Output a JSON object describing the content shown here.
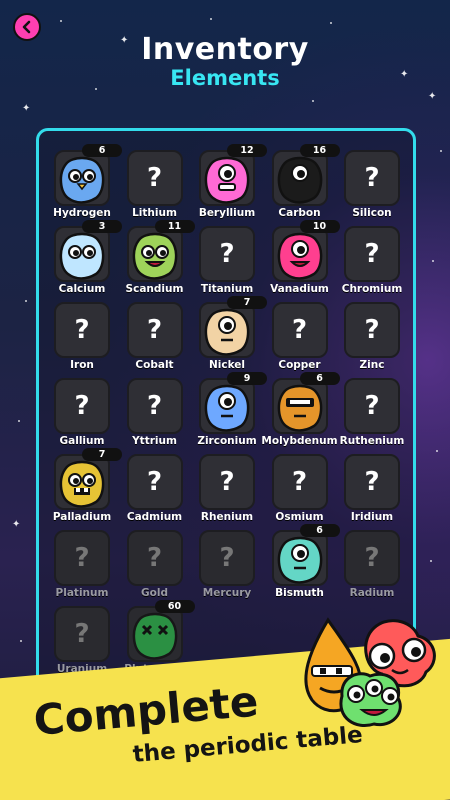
{
  "header": {
    "title": "Inventory",
    "subtitle": "Elements"
  },
  "colors": {
    "accent_cyan": "#33dceb",
    "back_button": "#ff3fb1",
    "banner": "#f6e24e"
  },
  "elements": [
    {
      "name": "Hydrogen",
      "count": "6",
      "discovered": true
    },
    {
      "name": "Lithium",
      "discovered": false
    },
    {
      "name": "Beryllium",
      "count": "12",
      "discovered": true
    },
    {
      "name": "Carbon",
      "count": "16",
      "discovered": true
    },
    {
      "name": "Silicon",
      "discovered": false
    },
    {
      "name": "Calcium",
      "count": "3",
      "discovered": true
    },
    {
      "name": "Scandium",
      "count": "11",
      "discovered": true
    },
    {
      "name": "Titanium",
      "discovered": false
    },
    {
      "name": "Vanadium",
      "count": "10",
      "discovered": true
    },
    {
      "name": "Chromium",
      "discovered": false
    },
    {
      "name": "Iron",
      "discovered": false
    },
    {
      "name": "Cobalt",
      "discovered": false
    },
    {
      "name": "Nickel",
      "count": "7",
      "discovered": true
    },
    {
      "name": "Copper",
      "discovered": false
    },
    {
      "name": "Zinc",
      "discovered": false
    },
    {
      "name": "Gallium",
      "discovered": false
    },
    {
      "name": "Yttrium",
      "discovered": false
    },
    {
      "name": "Zirconium",
      "count": "9",
      "discovered": true
    },
    {
      "name": "Molybdenum",
      "count": "6",
      "discovered": true
    },
    {
      "name": "Ruthenium",
      "discovered": false
    },
    {
      "name": "Palladium",
      "count": "7",
      "discovered": true
    },
    {
      "name": "Cadmium",
      "discovered": false
    },
    {
      "name": "Rhenium",
      "discovered": false
    },
    {
      "name": "Osmium",
      "discovered": false
    },
    {
      "name": "Iridium",
      "discovered": false
    },
    {
      "name": "Platinum",
      "discovered": false,
      "locked": true
    },
    {
      "name": "Gold",
      "discovered": false,
      "locked": true
    },
    {
      "name": "Mercury",
      "discovered": false,
      "locked": true
    },
    {
      "name": "Bismuth",
      "count": "6",
      "discovered": true
    },
    {
      "name": "Radium",
      "discovered": false,
      "locked": true
    },
    {
      "name": "Uranium",
      "discovered": false,
      "locked": true
    },
    {
      "name": "Plutonium",
      "count": "60",
      "discovered": true,
      "locked": true
    }
  ],
  "unknown_glyph": "?",
  "promo": {
    "line1": "Complete",
    "line2": "the periodic table"
  }
}
